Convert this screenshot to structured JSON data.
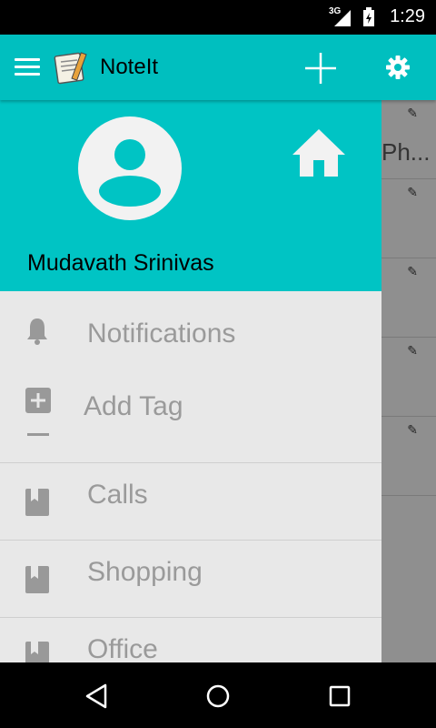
{
  "status_bar": {
    "network": "3G",
    "time": "1:29"
  },
  "app_bar": {
    "title": "NoteIt",
    "icons": [
      "menu-icon",
      "app-logo",
      "add-icon",
      "gear-icon"
    ]
  },
  "background_list": {
    "partial_text": "Ph..."
  },
  "drawer": {
    "user_name": "Mudavath Srinivas",
    "items": [
      {
        "label": "Notifications",
        "icon": "bell-icon"
      },
      {
        "label": "Add Tag",
        "icon": "add-box-icon"
      }
    ],
    "tags": [
      {
        "label": "Calls",
        "icon": "bookmark-book-icon"
      },
      {
        "label": "Shopping",
        "icon": "bookmark-book-icon"
      },
      {
        "label": "Office",
        "icon": "bookmark-book-icon"
      }
    ]
  },
  "colors": {
    "accent": "#00bfbf",
    "drawer_bg": "#e8e8e8",
    "label": "#9a9a9a"
  }
}
